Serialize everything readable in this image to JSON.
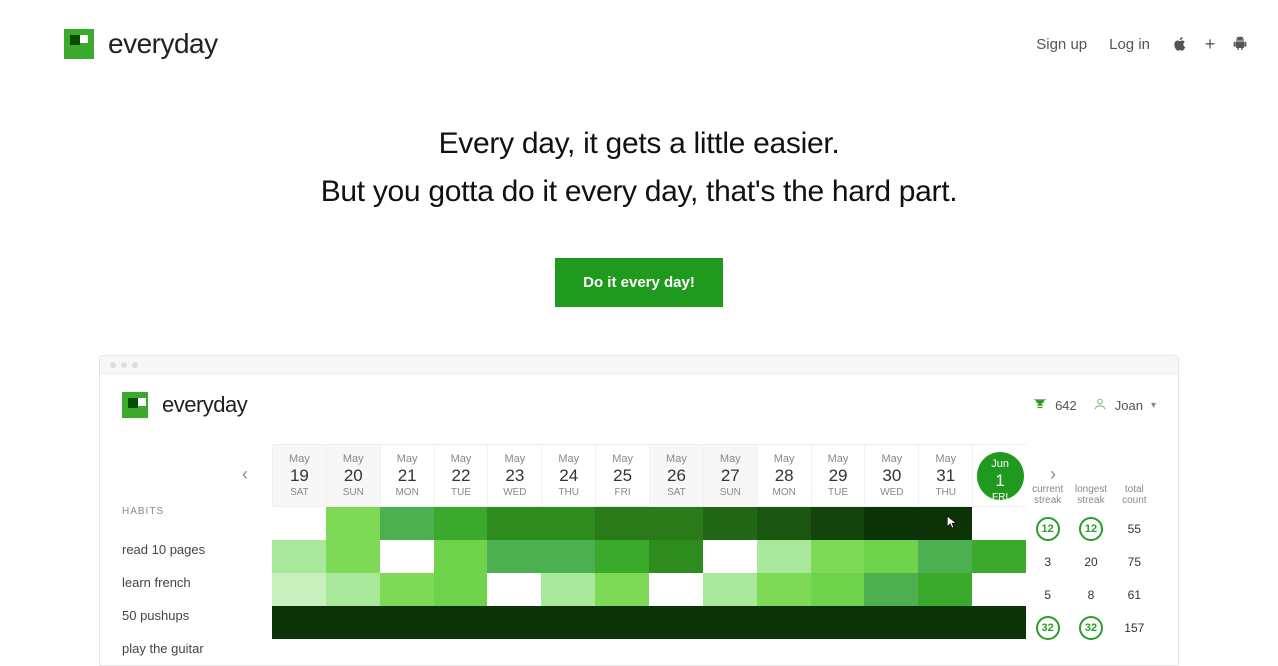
{
  "nav": {
    "brand": "everyday",
    "signup": "Sign up",
    "login": "Log in"
  },
  "hero": {
    "line1": "Every day, it gets a little easier.",
    "line2": "But you gotta do it every day, that's the hard part.",
    "cta": "Do it every day!"
  },
  "preview": {
    "brand": "everyday",
    "score": "642",
    "user": "Joan",
    "habits_label": "HABITS",
    "stats_head": {
      "current": "current streak",
      "longest": "longest streak",
      "total": "total count"
    },
    "days": [
      {
        "m": "May",
        "d": "19",
        "w": "SAT",
        "weekend": true
      },
      {
        "m": "May",
        "d": "20",
        "w": "SUN",
        "weekend": true
      },
      {
        "m": "May",
        "d": "21",
        "w": "MON",
        "weekend": false
      },
      {
        "m": "May",
        "d": "22",
        "w": "TUE",
        "weekend": false
      },
      {
        "m": "May",
        "d": "23",
        "w": "WED",
        "weekend": false
      },
      {
        "m": "May",
        "d": "24",
        "w": "THU",
        "weekend": false
      },
      {
        "m": "May",
        "d": "25",
        "w": "FRI",
        "weekend": false
      },
      {
        "m": "May",
        "d": "26",
        "w": "SAT",
        "weekend": true
      },
      {
        "m": "May",
        "d": "27",
        "w": "SUN",
        "weekend": true
      },
      {
        "m": "May",
        "d": "28",
        "w": "MON",
        "weekend": false
      },
      {
        "m": "May",
        "d": "29",
        "w": "TUE",
        "weekend": false
      },
      {
        "m": "May",
        "d": "30",
        "w": "WED",
        "weekend": false
      },
      {
        "m": "May",
        "d": "31",
        "w": "THU",
        "weekend": false
      },
      {
        "m": "Jun",
        "d": "1",
        "w": "FRI",
        "weekend": false,
        "today": true
      }
    ],
    "habits": [
      {
        "name": "read 10 pages",
        "cells": [
          "#ffffff",
          "#7ed957",
          "#4caf50",
          "#3aa92c",
          "#2e8b1e",
          "#2e8b1e",
          "#2a7a1a",
          "#2a7a1a",
          "#206614",
          "#1a5511",
          "#12440c",
          "#0c3308",
          "#0c3308",
          "#ffffff"
        ],
        "current": 12,
        "longest": 12,
        "total": 55,
        "ring": true
      },
      {
        "name": "learn french",
        "cells": [
          "#a8e89a",
          "#7ed957",
          "#ffffff",
          "#6fd24b",
          "#4caf50",
          "#4caf50",
          "#3aa92c",
          "#2e8b1e",
          "#ffffff",
          "#a8e89a",
          "#7ed957",
          "#6fd24b",
          "#4caf50",
          "#3aa92c"
        ],
        "current": 3,
        "longest": 20,
        "total": 75,
        "ring": false
      },
      {
        "name": "50 pushups",
        "cells": [
          "#c7f0bc",
          "#a8e89a",
          "#7ed957",
          "#6fd24b",
          "#ffffff",
          "#a8e89a",
          "#7ed957",
          "#ffffff",
          "#a8e89a",
          "#7ed957",
          "#6fd24b",
          "#4caf50",
          "#3aa92c",
          "#ffffff"
        ],
        "current": 5,
        "longest": 8,
        "total": 61,
        "ring": false
      },
      {
        "name": "play the guitar",
        "cells": [
          "#0c3308",
          "#0c3308",
          "#0c3308",
          "#0c3308",
          "#0c3308",
          "#0c3308",
          "#0c3308",
          "#0c3308",
          "#0c3308",
          "#0c3308",
          "#0c3308",
          "#0c3308",
          "#0c3308",
          "#0c3308"
        ],
        "current": 32,
        "longest": 32,
        "total": 157,
        "ring": true
      }
    ]
  }
}
